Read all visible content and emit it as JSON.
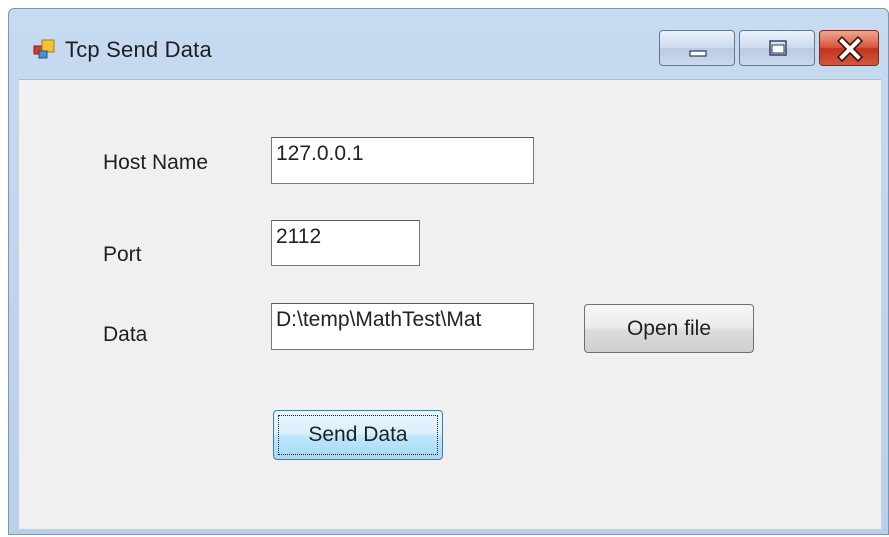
{
  "window": {
    "title": "Tcp Send Data",
    "controls": {
      "minimize": "minimize",
      "maximize": "maximize",
      "close": "close"
    }
  },
  "form": {
    "host": {
      "label": "Host Name",
      "value": "127.0.0.1"
    },
    "port": {
      "label": "Port",
      "value": "2112"
    },
    "data": {
      "label": "Data",
      "value": "D:\\temp\\MathTest\\Mat"
    },
    "open_file_label": "Open file",
    "send_data_label": "Send Data"
  },
  "colors": {
    "titlebar": "#c6daf0",
    "client": "#f0f0f0",
    "close_button": "#c2331b",
    "default_button_border": "#3c7fb1"
  },
  "icons": [
    "app-icon",
    "minimize-icon",
    "maximize-icon",
    "close-icon"
  ]
}
